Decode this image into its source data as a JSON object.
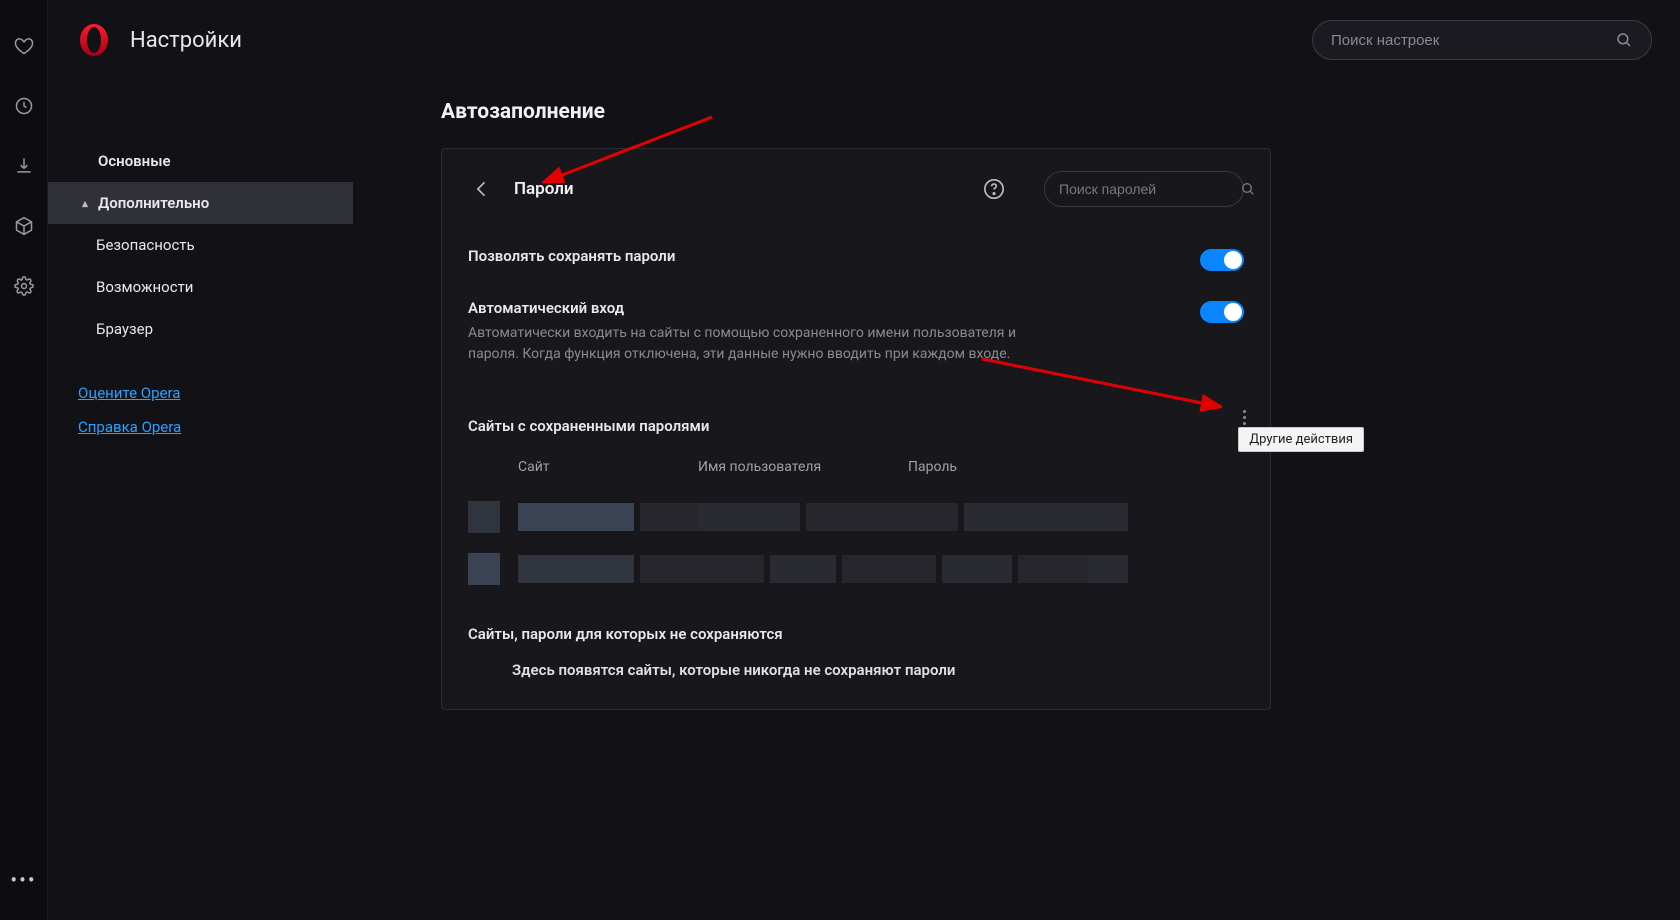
{
  "topbar": {
    "title": "Настройки",
    "search_placeholder": "Поиск настроек"
  },
  "sidebar": {
    "items": [
      {
        "label": "Основные",
        "kind": "top"
      },
      {
        "label": "Дополнительно",
        "kind": "top-expanded"
      },
      {
        "label": "Безопасность",
        "kind": "sub"
      },
      {
        "label": "Возможности",
        "kind": "sub"
      },
      {
        "label": "Браузер",
        "kind": "sub"
      }
    ],
    "links": [
      {
        "label": "Оцените Opera"
      },
      {
        "label": "Справка Opera"
      }
    ]
  },
  "content": {
    "section_heading": "Автозаполнение",
    "panel": {
      "title": "Пароли",
      "search_placeholder": "Поиск паролей",
      "rows": [
        {
          "label": "Позволять сохранять пароли",
          "desc": "",
          "on": true
        },
        {
          "label": "Автоматический вход",
          "desc": "Автоматически входить на сайты с помощью сохраненного имени пользователя и пароля. Когда функция отключена, эти данные нужно вводить при каждом входе.",
          "on": true
        }
      ],
      "saved_section_title": "Сайты с сохраненными паролями",
      "table_headers": {
        "site": "Сайт",
        "user": "Имя пользователя",
        "password": "Пароль"
      },
      "never_section_title": "Сайты, пароли для которых не сохраняются",
      "never_empty_text": "Здесь появятся сайты, которые никогда не сохраняют пароли",
      "more_tooltip": "Другие действия"
    }
  }
}
